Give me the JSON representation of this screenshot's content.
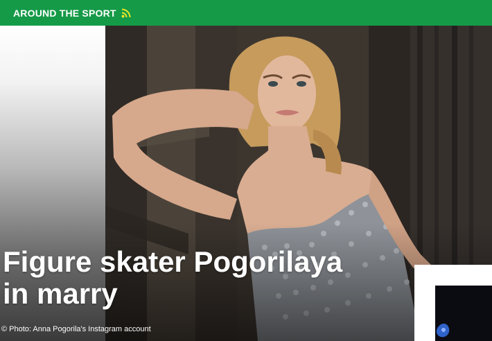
{
  "section": {
    "title": "AROUND THE SPORT",
    "rss_icon": "rss-feed-icon"
  },
  "article": {
    "headline": "Figure skater Pogorilaya in marry",
    "photo_credit": "© Photo: Anna Pogorila's Instagram account"
  },
  "colors": {
    "brand_green": "#159a48",
    "rss_yellow": "#e9e62a",
    "headline_text": "#ffffff"
  }
}
